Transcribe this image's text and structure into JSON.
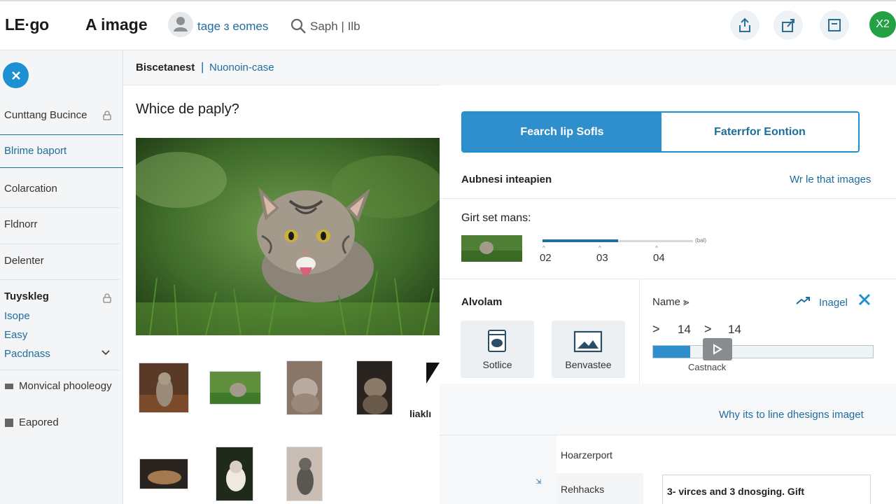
{
  "header": {
    "logo": "LE·go",
    "title": "A image",
    "profile_link": "tage ɜ eomes",
    "search_placeholder": "Saph | Ilb",
    "user_initials": "X2"
  },
  "sidebar": {
    "items": [
      {
        "label": "Cunttang Bucince",
        "icon": "lock-icon"
      },
      {
        "label": "Blrime baport",
        "active": true
      },
      {
        "label": "Colarcation"
      },
      {
        "label": "Fldnorr"
      },
      {
        "label": "Delenter"
      }
    ],
    "section": {
      "title": "Tuyskleg",
      "icon": "lock-icon",
      "subitems": [
        "Isope",
        "Easy",
        "Pacdnass"
      ]
    },
    "footer_items": [
      "Monvical phooleogy",
      "Eapored"
    ]
  },
  "breadcrumb": {
    "first": "Biscetanest",
    "separator": "|",
    "second": "Nuonoin-case"
  },
  "main": {
    "question": "Whice de paply?",
    "cropped_caption": "liaklı"
  },
  "right": {
    "segmented": {
      "left": "Fearch lip Sofls",
      "right": "Faterrfor Eontion"
    },
    "section1": {
      "title": "Aubnesi inteapien",
      "link": "Wr le that images"
    },
    "gift": {
      "title": "Girt set mans:",
      "progress": 0.5,
      "tick_labels": [
        "02",
        "03",
        "04"
      ],
      "end_label": "(bal)"
    },
    "alvolam": {
      "title": "Alvolam",
      "tiles": [
        "Sotlice",
        "Benvastee"
      ]
    },
    "name_panel": {
      "label": "Name ⪢",
      "link": "Inagel",
      "values": [
        ">",
        "14",
        ">",
        "14"
      ],
      "slider_level": 0.17,
      "caption": "Castnack"
    },
    "bottom_link": "Why its to line dhesigns imaget",
    "list": [
      "Hoarzerport",
      "Rehhacks"
    ],
    "output": "3- virces and 3 dnosging. Gift"
  },
  "colors": {
    "accent": "#1d8fd3",
    "link": "#1f6d9c",
    "user_badge": "#24a145"
  }
}
